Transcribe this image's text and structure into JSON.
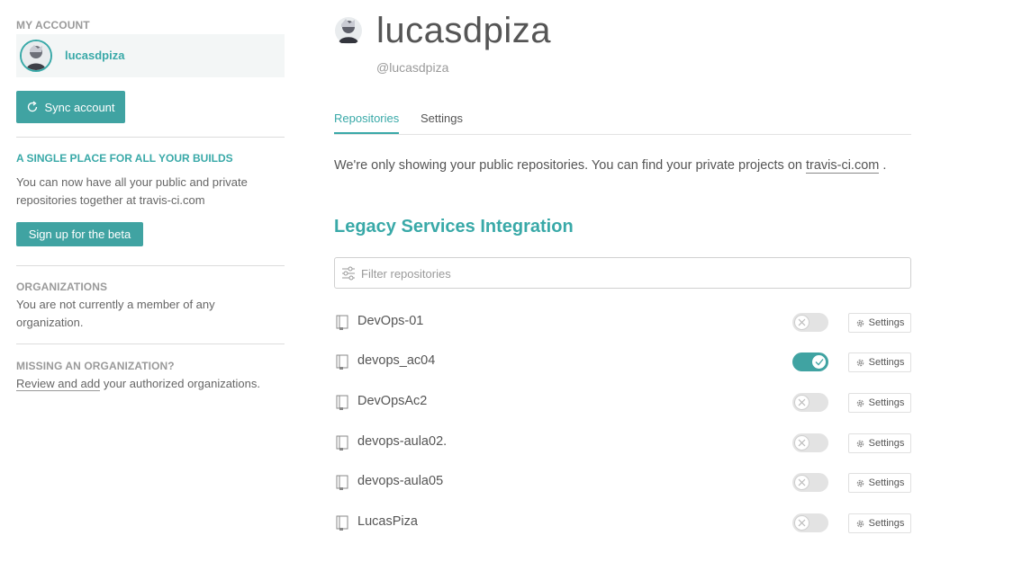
{
  "sidebar": {
    "my_account_heading": "MY ACCOUNT",
    "account_name": "lucasdpiza",
    "sync_button_label": "Sync account",
    "beta_heading": "A SINGLE PLACE FOR ALL YOUR BUILDS",
    "beta_text": "You can now have all your public and private repositories together at travis-ci.com",
    "beta_button_label": "Sign up for the beta",
    "organizations_heading": "ORGANIZATIONS",
    "organizations_text": "You are not currently a member of any organization.",
    "missing_heading": "MISSING AN ORGANIZATION?",
    "missing_link": "Review and add",
    "missing_text": " your authorized organizations."
  },
  "profile": {
    "name": "lucasdpiza",
    "handle": "@lucasdpiza"
  },
  "tabs": [
    {
      "label": "Repositories",
      "active": true
    },
    {
      "label": "Settings",
      "active": false
    }
  ],
  "info": {
    "text": "We're only showing your public repositories. You can find your private projects on ",
    "link": "travis-ci.com",
    "suffix": " ."
  },
  "section_title": "Legacy Services Integration",
  "filter": {
    "placeholder": "Filter repositories"
  },
  "repo_settings_label": "Settings",
  "repositories": [
    {
      "name": "DevOps-01",
      "active": false
    },
    {
      "name": "devops_ac04",
      "active": true
    },
    {
      "name": "DevOpsAc2",
      "active": false
    },
    {
      "name": "devops-aula02.",
      "active": false
    },
    {
      "name": "devops-aula05",
      "active": false
    },
    {
      "name": "LucasPiza",
      "active": false
    }
  ],
  "colors": {
    "accent": "#39a9a8",
    "button": "#40a3a2",
    "toggle_off": "#e3e3e3"
  },
  "icons": {
    "sync": "sync-icon",
    "filter": "filter-sliders-icon",
    "repo": "repo-book-icon",
    "gear": "gear-icon",
    "check": "check-icon",
    "cross": "cross-icon"
  }
}
